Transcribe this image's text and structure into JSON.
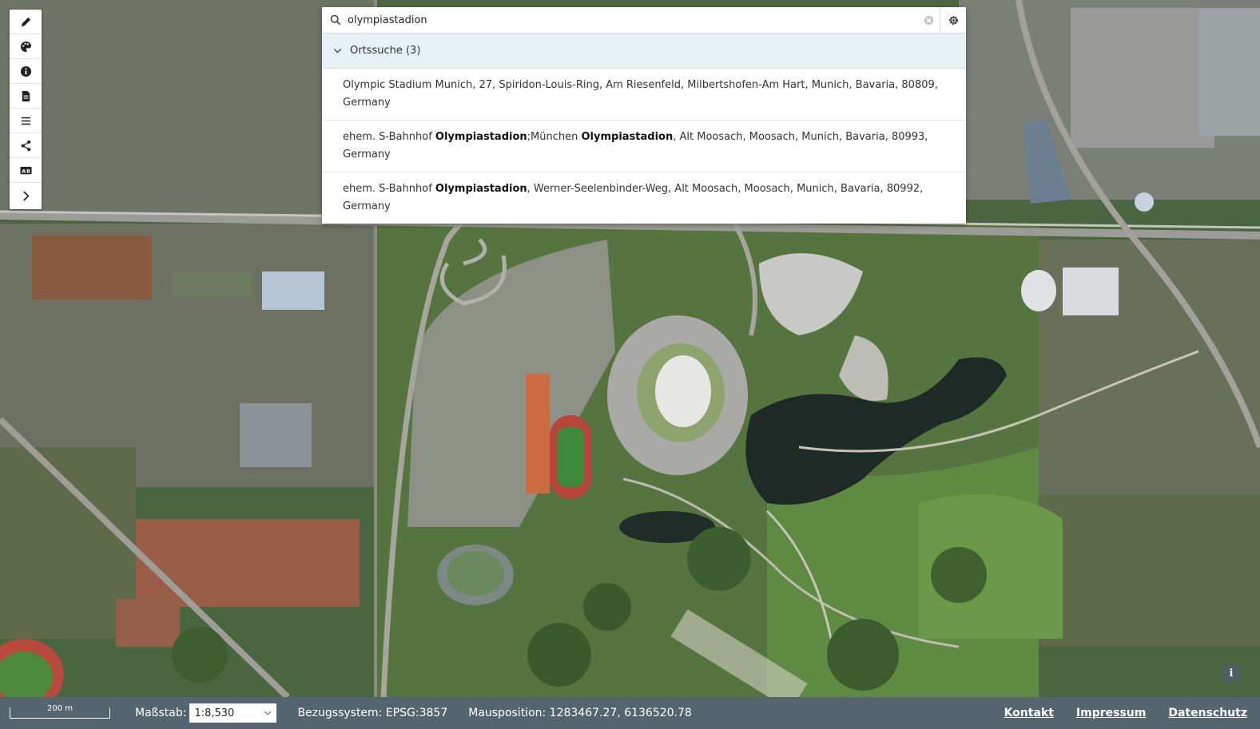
{
  "search": {
    "query": "olympiastadion",
    "group_label": "Ortssuche (3)",
    "results": [
      [
        {
          "t": "Olympic Stadium Munich, 27, Spiridon-Louis-Ring, Am Riesenfeld, Milbertshofen-Am Hart, Munich, Bavaria, 80809, Germany",
          "b": false
        }
      ],
      [
        {
          "t": "ehem. S-Bahnhof ",
          "b": false
        },
        {
          "t": "Olympiastadion",
          "b": true
        },
        {
          "t": ";München ",
          "b": false
        },
        {
          "t": "Olympiastadion",
          "b": true
        },
        {
          "t": ", Alt Moosach, Moosach, Munich, Bavaria, 80993, Germany",
          "b": false
        }
      ],
      [
        {
          "t": "ehem. S-Bahnhof ",
          "b": false
        },
        {
          "t": "Olympiastadion",
          "b": true
        },
        {
          "t": ", Werner-Seelenbinder-Weg, Alt Moosach, Moosach, Munich, Bavaria, 80992, Germany",
          "b": false
        }
      ]
    ]
  },
  "toolbar": {
    "icons": [
      "pencil-icon",
      "palette-icon",
      "info-icon",
      "document-icon",
      "menu-icon",
      "share-icon",
      "ab-icon",
      "chevron-right-icon"
    ]
  },
  "map": {
    "info_label": "i"
  },
  "footer": {
    "scalebar_label": "200 m",
    "scale_label": "Maßstab:",
    "scale_value": "1:8,530",
    "crs": "Bezugssystem: EPSG:3857",
    "mouse_position": "Mausposition: 1283467.27, 6136520.78",
    "links": [
      "Kontakt",
      "Impressum",
      "Datenschutz"
    ]
  }
}
